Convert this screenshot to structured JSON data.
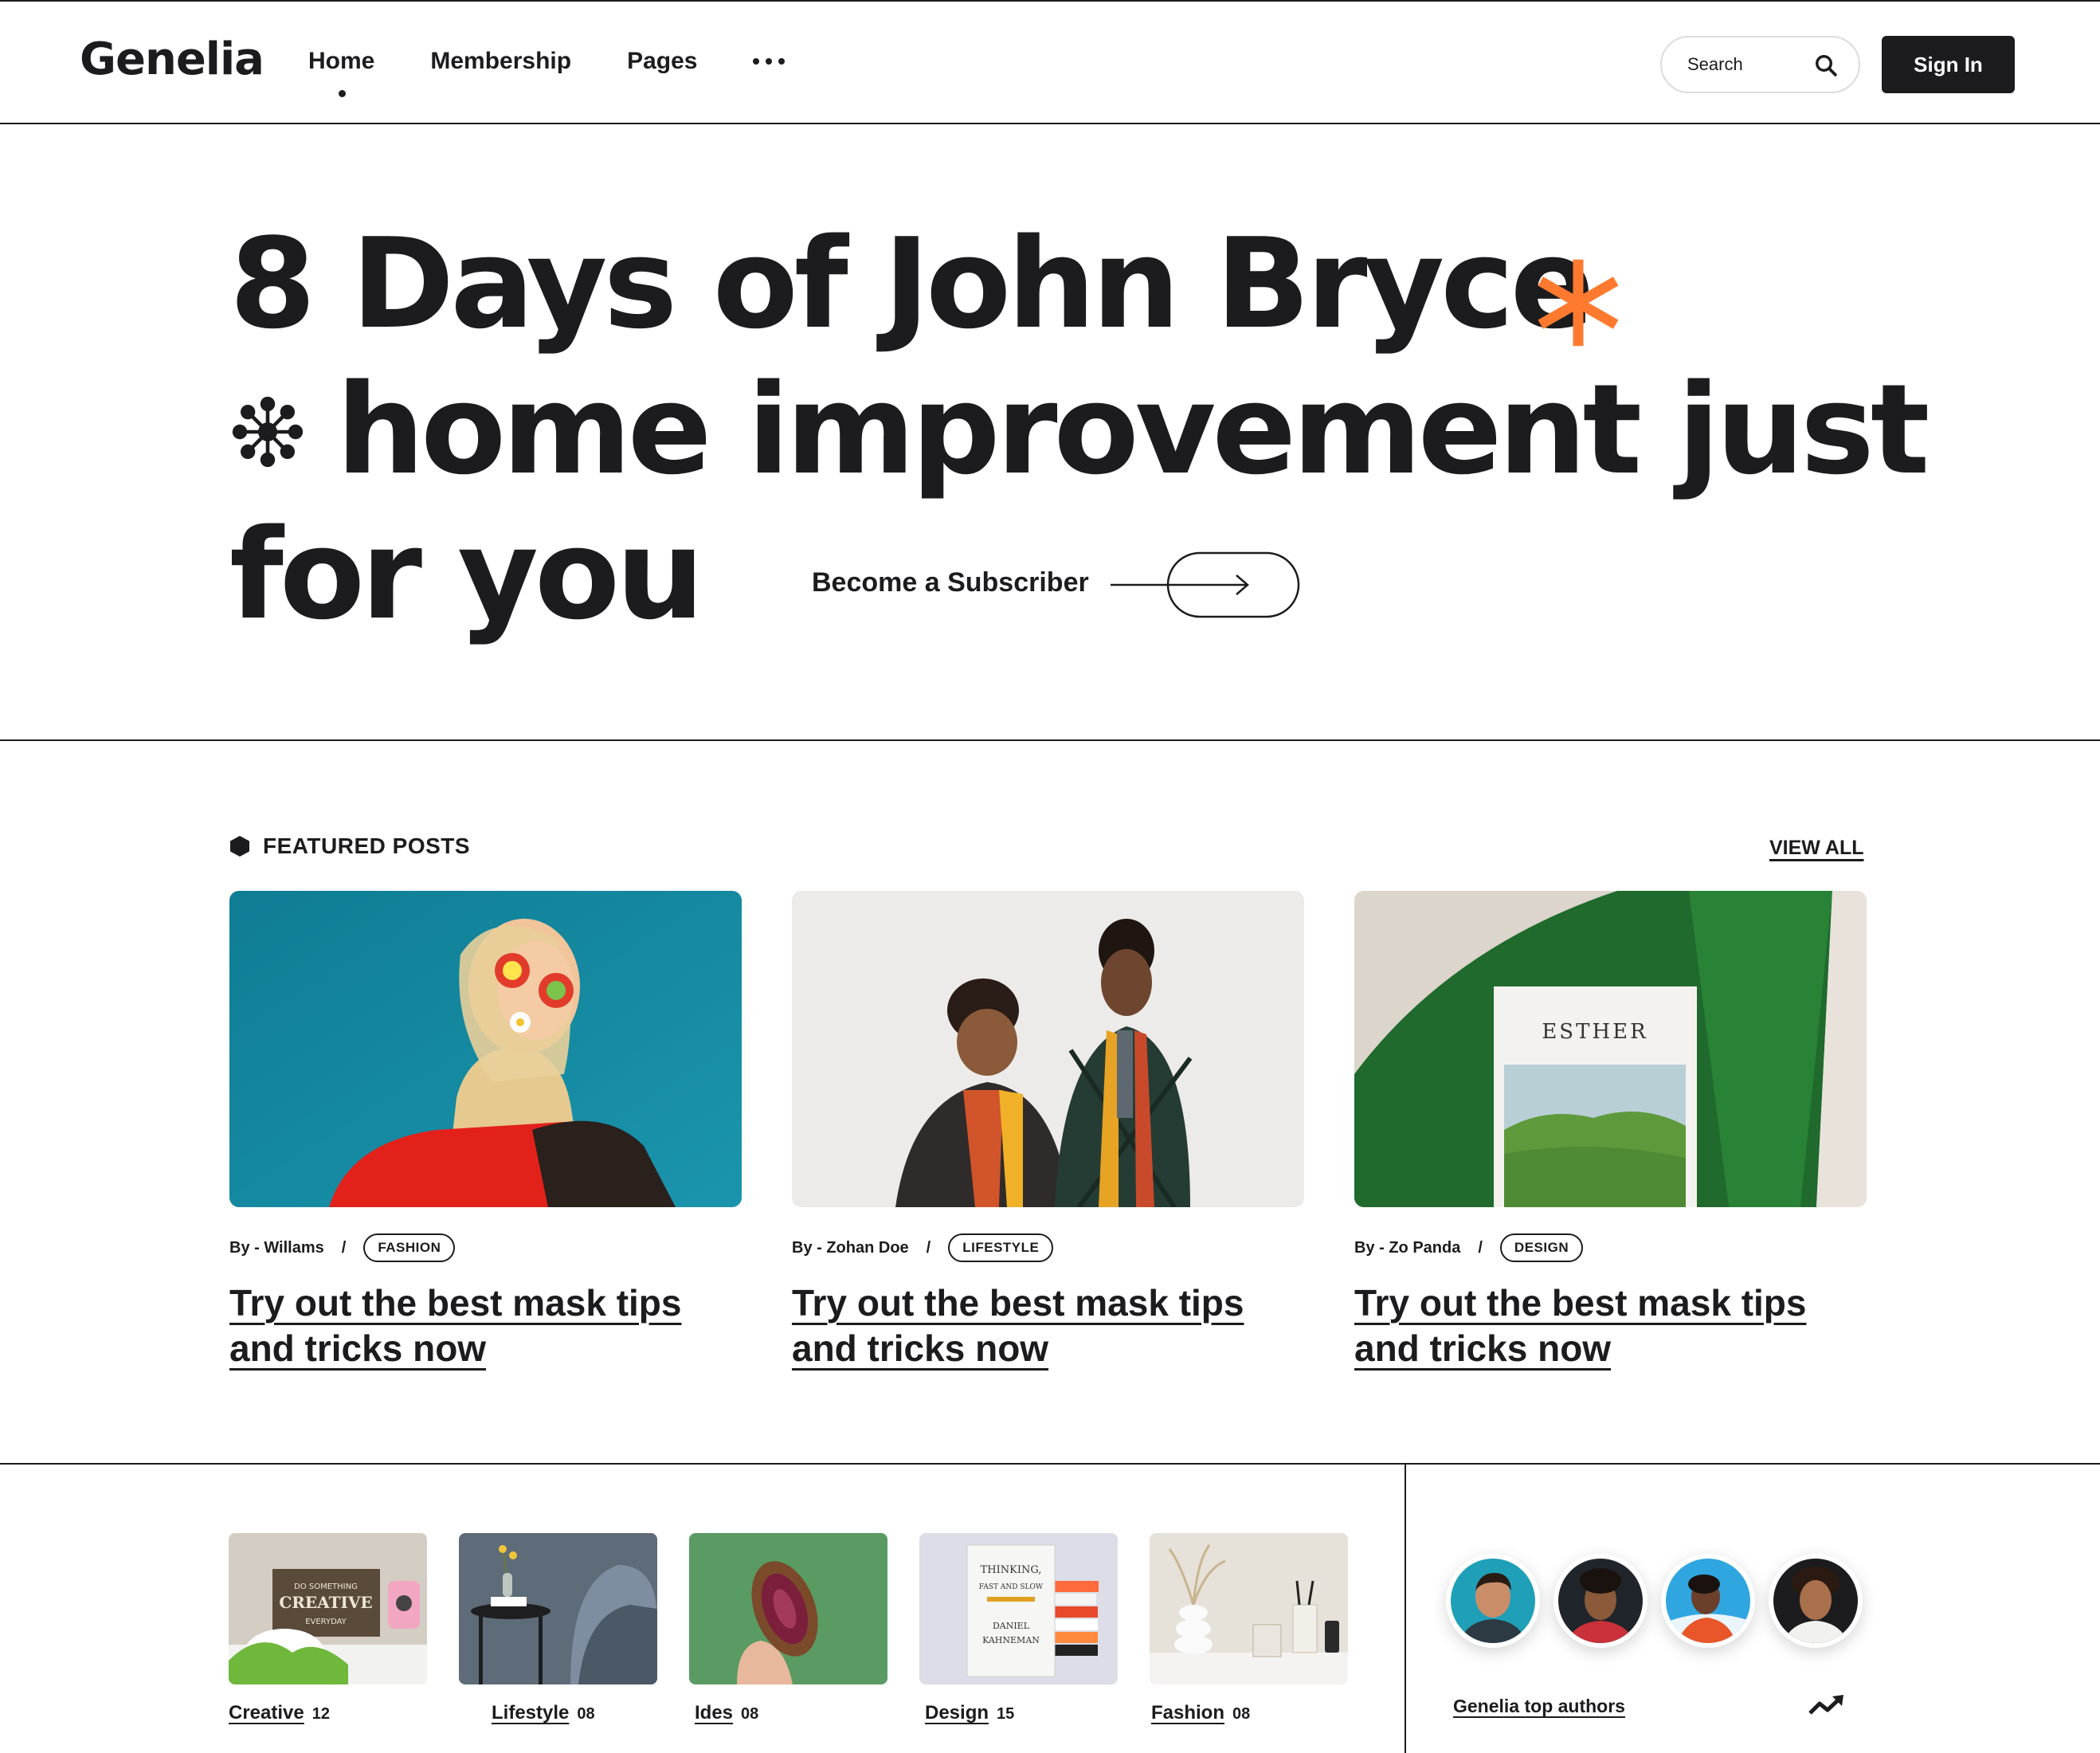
{
  "brand": {
    "logo": "Genelia"
  },
  "nav": {
    "items": [
      {
        "label": "Home",
        "active": true
      },
      {
        "label": "Membership",
        "active": false
      },
      {
        "label": "Pages",
        "active": false
      }
    ],
    "more_icon": "more-dots-icon"
  },
  "search": {
    "placeholder": "Search",
    "icon": "search-icon"
  },
  "header": {
    "signin_label": "Sign In"
  },
  "hero": {
    "line1": "8 Days of John Bryce",
    "line2": "home improvement just",
    "line3": "for you",
    "accent_color": "#FF7A2F",
    "subscribe_label": "Become a Subscriber"
  },
  "featured": {
    "title": "FEATURED POSTS",
    "view_all": "VIEW ALL",
    "posts": [
      {
        "author": "By - Willams",
        "category": "FASHION",
        "title_line1": "Try out the best mask tips",
        "title_line2": "and tricks now"
      },
      {
        "author": "By - Zohan Doe",
        "category": "LIFESTYLE",
        "title_line1": "Try out the best mask tips",
        "title_line2": "and tricks now"
      },
      {
        "author": "By - Zo Panda",
        "category": "DESIGN",
        "title_line1": "Try out the best mask tips",
        "title_line2": "and tricks now",
        "book_title": "ESTHER"
      }
    ]
  },
  "categories": [
    {
      "name": "Creative",
      "count": "12",
      "sign_line1": "DO SOMETHING",
      "sign_line2": "CREATIVE",
      "sign_line3": "EVERYDAY"
    },
    {
      "name": "Lifestyle",
      "count": "08"
    },
    {
      "name": "Ides",
      "count": "08"
    },
    {
      "name": "Design",
      "count": "15",
      "book_line1": "THINKING,",
      "book_line2": "FAST AND SLOW",
      "book_line3": "DANIEL",
      "book_line4": "KAHNEMAN"
    },
    {
      "name": "Fashion",
      "count": "08"
    }
  ],
  "authors": {
    "label": "Genelia top authors",
    "count": 4,
    "trend_icon": "trending-up-icon"
  }
}
